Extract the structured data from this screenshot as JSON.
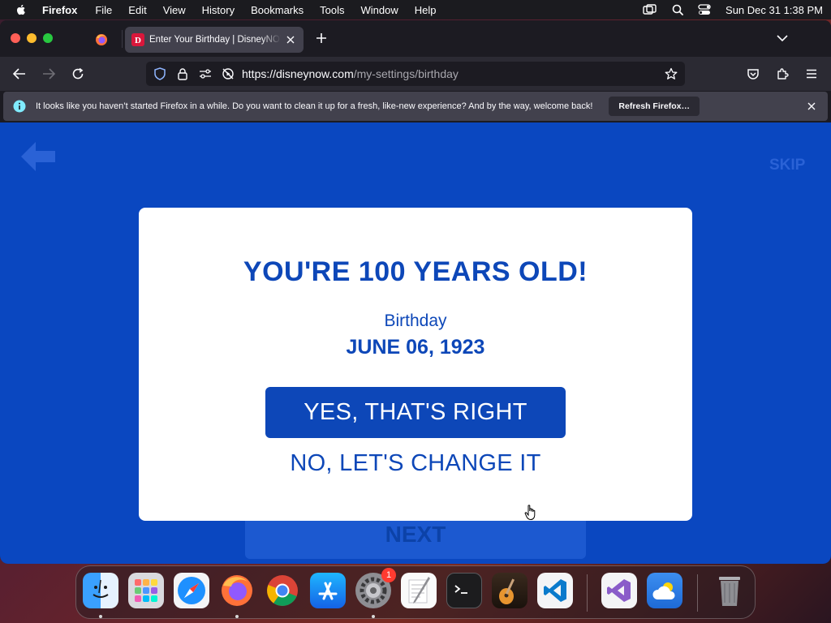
{
  "menubar": {
    "app_name": "Firefox",
    "items": [
      "File",
      "Edit",
      "View",
      "History",
      "Bookmarks",
      "Tools",
      "Window",
      "Help"
    ],
    "clock": "Sun Dec 31  1:38 PM"
  },
  "browser": {
    "tab_title": "Enter Your Birthday | DisneyNOW",
    "url_host": "https://disneynow.com",
    "url_path": "/my-settings/birthday",
    "notification_text": "It looks like you haven’t started Firefox in a while. Do you want to clean it up for a fresh, like-new experience? And by the way, welcome back!",
    "refresh_label": "Refresh Firefox…"
  },
  "page": {
    "skip_label": "SKIP",
    "next_label": "NEXT",
    "headline": "YOU'RE 100 YEARS OLD!",
    "birthday_label": "Birthday",
    "birthday_date": "JUNE 06, 1923",
    "confirm_label": "YES, THAT'S RIGHT",
    "change_label": "NO, LET'S CHANGE IT"
  },
  "dock": {
    "apps": [
      "Finder",
      "Launchpad",
      "Safari",
      "Firefox",
      "Google Chrome",
      "App Store",
      "System Settings",
      "TextEdit",
      "Terminal",
      "GarageBand",
      "Visual Studio Code",
      "Visual Studio",
      "Weather",
      "Trash"
    ],
    "system_settings_badge": "1"
  }
}
